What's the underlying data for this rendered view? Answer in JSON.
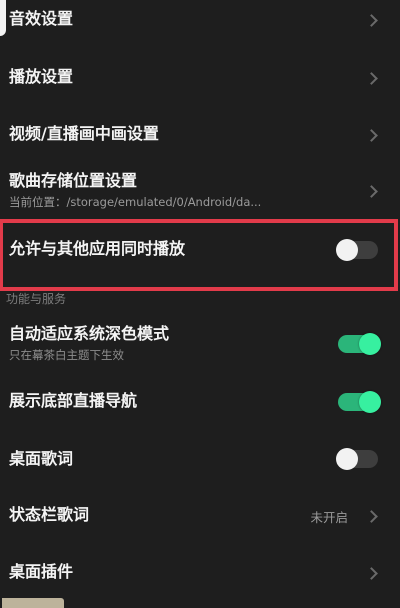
{
  "settings": {
    "sound_effects": "音效设置",
    "playback": "播放设置",
    "pip": "视频/直播画中画设置",
    "storage": {
      "label": "歌曲存储位置设置",
      "current": "当前位置：/storage/emulated/0/Android/da..."
    },
    "allow_simultaneous": {
      "label": "允许与其他应用同时播放",
      "enabled": false
    }
  },
  "section_title": "功能与服务",
  "features": {
    "dark_mode": {
      "label": "自动适应系统深色模式",
      "hint": "只在幕茶白主题下生效",
      "enabled": true
    },
    "live_nav": {
      "label": "展示底部直播导航",
      "enabled": true
    },
    "desktop_lyrics": {
      "label": "桌面歌词",
      "enabled": false
    },
    "statusbar_lyrics": {
      "label": "状态栏歌词",
      "value": "未开启"
    },
    "widgets": "桌面插件"
  },
  "colors": {
    "background": "#1e1e1e",
    "accent_on": "#37f0a0",
    "highlight_border": "#e23b4a"
  }
}
